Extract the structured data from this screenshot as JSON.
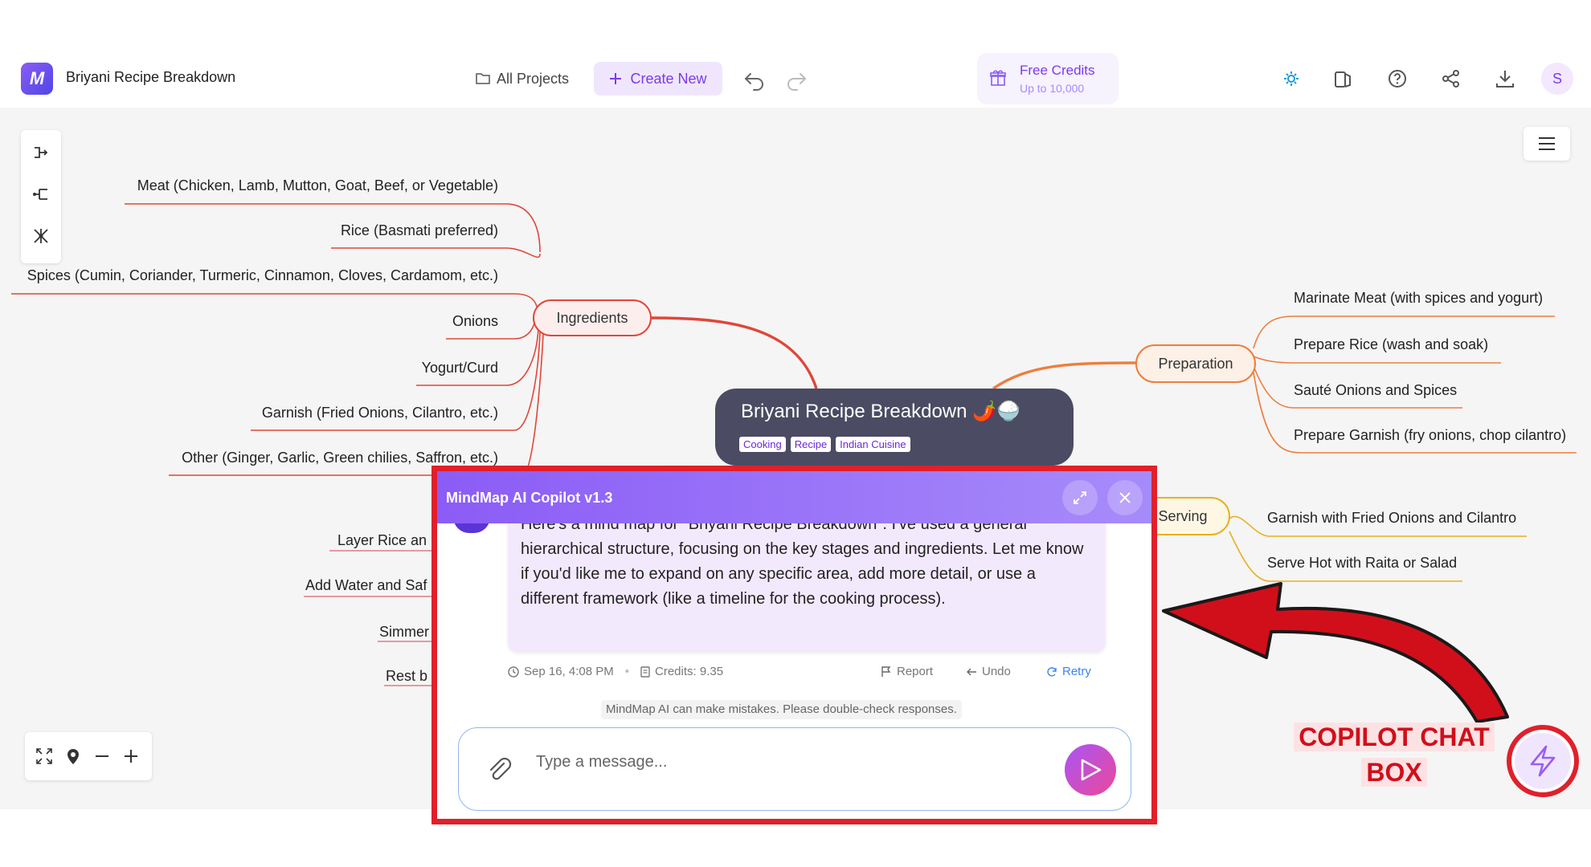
{
  "app": {
    "logo_letter": "M",
    "title": "Briyani Recipe Breakdown"
  },
  "header": {
    "all_projects": "All Projects",
    "create_new": "Create New",
    "credits_title": "Free Credits",
    "credits_sub": "Up to 10,000",
    "avatar_letter": "S"
  },
  "mindmap": {
    "central_title": "Briyani Recipe Breakdown 🌶️🍚",
    "tags": [
      "Cooking",
      "Recipe",
      "Indian Cuisine"
    ],
    "branches": {
      "ingredients": {
        "label": "Ingredients",
        "color": "#e0463a",
        "children": [
          "Meat (Chicken, Lamb, Mutton, Goat, Beef, or Vegetable)",
          "Rice (Basmati preferred)",
          "Spices (Cumin, Coriander, Turmeric, Cinnamon, Cloves, Cardamom, etc.)",
          "Onions",
          "Yogurt/Curd",
          "Garnish (Fried Onions, Cilantro, etc.)",
          "Other (Ginger, Garlic, Green chilies, Saffron, etc.)"
        ]
      },
      "cooking": {
        "color": "#e07b86",
        "children": [
          "Layer Rice an",
          "Add Water and Saf",
          "Simmer",
          "Rest b"
        ]
      },
      "preparation": {
        "label": "Preparation",
        "color": "#ef7d3c",
        "children": [
          "Marinate Meat (with spices and yogurt)",
          "Prepare Rice (wash and soak)",
          "Sauté Onions and Spices",
          "Prepare Garnish (fry onions, chop cilantro)"
        ]
      },
      "serving": {
        "label": "Serving",
        "color": "#e8b020",
        "children": [
          "Garnish with Fried Onions and Cilantro",
          "Serve Hot with Raita or Salad"
        ]
      }
    }
  },
  "copilot": {
    "title": "MindMap AI Copilot v1.3",
    "message": "Here's a mind map for \"Briyani Recipe Breakdown\". I've used a general hierarchical structure, focusing on the key stages and ingredients. Let me know if you'd like me to expand on any specific area, add more detail, or use a different framework (like a timeline for the cooking process).",
    "timestamp": "Sep 16, 4:08 PM",
    "credits": "Credits: 9.35",
    "report": "Report",
    "undo": "Undo",
    "retry": "Retry",
    "disclaimer": "MindMap AI can make mistakes. Please double-check responses.",
    "input_placeholder": "Type a message..."
  },
  "annotation": {
    "line1": "COPILOT CHAT",
    "line2": "BOX",
    "color": "#d10f1a"
  }
}
